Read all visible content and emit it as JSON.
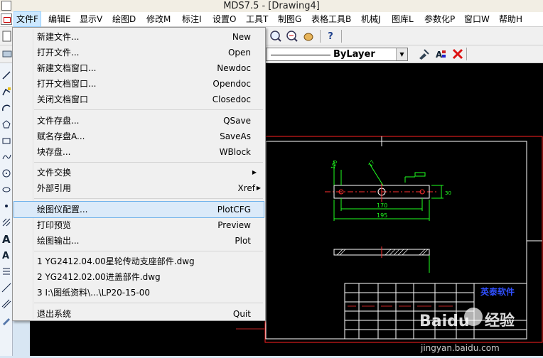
{
  "window": {
    "title": "MDS7.5 - [Drawing4]"
  },
  "menubar": {
    "items": [
      {
        "label": "文件F",
        "active": true
      },
      {
        "label": "编辑E"
      },
      {
        "label": "显示V"
      },
      {
        "label": "绘图D"
      },
      {
        "label": "修改M"
      },
      {
        "label": "标注I"
      },
      {
        "label": "设置O"
      },
      {
        "label": "工具T"
      },
      {
        "label": "制图G"
      },
      {
        "label": "表格工具B"
      },
      {
        "label": "机械J"
      },
      {
        "label": "图库L"
      },
      {
        "label": "参数化P"
      },
      {
        "label": "窗口W"
      },
      {
        "label": "帮助H"
      }
    ]
  },
  "toolbar": {
    "layer_value": "ByLayer",
    "help_label": "?"
  },
  "file_menu": {
    "groups": [
      [
        {
          "label": "新建文件...",
          "shortcut": "New"
        },
        {
          "label": "打开文件...",
          "shortcut": "Open"
        },
        {
          "label": "新建文档窗口...",
          "shortcut": "Newdoc"
        },
        {
          "label": "打开文档窗口...",
          "shortcut": "Opendoc"
        },
        {
          "label": "关闭文档窗口",
          "shortcut": "Closedoc"
        }
      ],
      [
        {
          "label": "文件存盘...",
          "shortcut": "QSave"
        },
        {
          "label": "赋名存盘A...",
          "shortcut": "SaveAs"
        },
        {
          "label": "块存盘...",
          "shortcut": "WBlock"
        }
      ],
      [
        {
          "label": "文件交换",
          "shortcut": "",
          "submenu": true
        },
        {
          "label": "外部引用",
          "shortcut": "Xref",
          "submenu": true
        }
      ],
      [
        {
          "label": "绘图仪配置...",
          "shortcut": "PlotCFG",
          "highlighted": true
        },
        {
          "label": "打印预览",
          "shortcut": "Preview"
        },
        {
          "label": "绘图输出...",
          "shortcut": "Plot"
        }
      ],
      [
        {
          "label": "1 YG2412.04.00星轮传动支座部件.dwg",
          "shortcut": ""
        },
        {
          "label": "2 YG2412.02.00进盖部件.dwg",
          "shortcut": ""
        },
        {
          "label": "3 I:\\图纸资料\\...\\LP20-15-00",
          "shortcut": ""
        }
      ],
      [
        {
          "label": "退出系统",
          "shortcut": "Quit"
        }
      ]
    ]
  },
  "drawing": {
    "dim_170": "170",
    "dim_195": "195",
    "dim_30": "30",
    "dim_120": "120",
    "dim_17": "17",
    "company": "英泰软件",
    "colors": {
      "frame": "#ff2020",
      "part": "#ffffff",
      "dims": "#20ff20",
      "center": "#ff3030",
      "label": "#0000ff"
    }
  },
  "watermark": {
    "brand": "Baidu",
    "text": "经验",
    "url": "jingyan.baidu.com"
  }
}
